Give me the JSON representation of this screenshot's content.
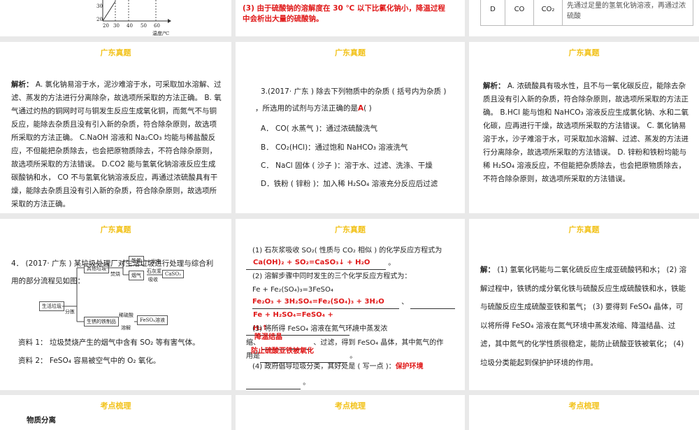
{
  "slide1": {
    "axis_ticks": [
      "20",
      "30",
      "20",
      "30",
      "40",
      "50",
      "60"
    ],
    "axis_label": "温度/℃"
  },
  "slide2": {
    "answer": "(3) 由于硫酸钠的溶解度在 30 ℃ 以下比氯化钠小，降温过程中会析出大量的硫酸钠。"
  },
  "slide3": {
    "row": [
      "D",
      "CO",
      "CO₂",
      "先通过足量的氢氧化钠溶液，再通过浓硫酸"
    ]
  },
  "section_title": "广东真题",
  "slide4": {
    "label": "解析：",
    "text": " A. 氯化钠易溶于水，泥沙难溶于水，可采取加水溶解、过滤、蒸发的方法进行分离除杂，故选项所采取的方法正确。 B. 氧气通过灼热的铜网时可与铜发生反应生成氧化铜，而氮气不与铜反应，能除去杂质且没有引入新的杂质，符合除杂原则，故选项所采取的方法正确。 C.NaOH 溶液和 Na₂CO₃ 均能与稀盐酸反应，不但能把杂质除去，也会把原物质除去，不符合除杂原则，故选项所采取的方法错误。 D.CO2 能与氢氧化钠溶液反应生成碳酸钠和水， CO 不与氢氧化钠溶液反应，再通过浓硫酸具有干燥，能除去杂质且没有引入新的杂质，符合除杂原则，故选项所采取的方法正确。"
  },
  "slide5": {
    "q1": "3.(2017· 广东 ) 除去下列物质中的杂质 ( 括号内为杂质 )",
    "q2": "，所选用的试剂与方法正确的是",
    "answer": "A",
    "paren": "(          )",
    "options": [
      "A． CO( 水蒸气 )：通过浓硫酸洗气",
      "B． CO₂(HCl)：通过饱和 NaHCO₃ 溶液洗气",
      "C． NaCl 固体 ( 沙子 )：溶于水、过滤、洗涤、干燥",
      "D．铁粉 ( 锌粉 )：加入稀 H₂SO₄ 溶液充分反应后过滤"
    ]
  },
  "slide6": {
    "label": "解析：",
    "text": " A. 浓硫酸具有吸水性，且不与一氧化碳反应，能除去杂质且没有引入新的杂质，符合除杂原则，故选项所采取的方法正确。 B.HCl 能与饱和 NaHCO₃ 溶液反应生成氯化钠、水和二氧化碳，应再进行干燥，故选项所采取的方法错误。 C. 氯化钠易溶于水，沙子难溶于水，可采取加水溶解、过滤、蒸发的方法进行分离除杂，故选项所采取的方法错误。 D. 锌粉和铁粉均能与稀 H₂SO₄ 溶液反应，不但能把杂质除去，也会把原物质除去，不符合除杂原则，故选项所采取的方法错误。"
  },
  "slide7": {
    "q": "4． (2017· 广东 ) 某垃圾处理厂对生活垃圾进行处理与综合利用的部分流程见如图：",
    "flow": {
      "start": "生活垃圾",
      "sort": "分拣",
      "other": "其他垃圾",
      "burn": "焚烧",
      "energy": "能量",
      "power": "发电",
      "smoke": "烟气",
      "lime": "石灰浆",
      "absorb": "吸收",
      "caso3": "CaSO₃",
      "rusty": "生锈的铁制品",
      "acid": "稀硫酸",
      "dissolve": "溶解",
      "feso4": "FeSO₄溶液"
    },
    "info1": "资料 1： 垃圾焚烧产生的烟气中含有 SO₂ 等有害气体。",
    "info2": "资料 2： FeSO₄ 容易被空气中的 O₂ 氧化。"
  },
  "slide8": {
    "q1": "(1) 石灰浆吸收 SO₂( 性质与 CO₂ 相似 ) 的化学反应方程式为",
    "a1": "Ca(OH)₂ + SO₂=CaSO₃↓ + H₂O",
    "q2": "(2) 溶解步骤中同时发生的三个化学反应方程式为：",
    "eq1": "Fe + Fe₂(SO₄)₃=3FeSO₄",
    "a2": "Fe₂O₃ + 3H₂SO₄=Fe₂(SO₄)₃ + 3H₂O",
    "a3": "Fe + H₂SO₄=FeSO₄ + H₂↑",
    "q3a": "(3) 将所得 FeSO₄ 溶液在氮气环境中蒸发浓",
    "q3b": "缩、",
    "q3c": "、过滤，得到 FeSO₄ 晶体，其中氮气的作",
    "q3d": "用是",
    "a3a": "降温结晶",
    "a3b": "防止硫酸亚铁被氧化",
    "q4": "(4) 政府倡导垃圾分类，其好处是 ( 写一点 )：",
    "a4": "保护环境",
    "dot": "。",
    "sep": "、"
  },
  "slide9": {
    "label": "解：",
    "text": " (1) 氢氧化钙能与二氧化硫反应生成亚硫酸钙和水； (2) 溶解过程中，铁锈的成分氧化铁与硫酸反应生成硫酸铁和水，铁能与硫酸反应生成硫酸亚铁和氢气； (3) 要得到 FeSO₄ 晶体，可以将所得 FeSO₄ 溶液在氮气环境中蒸发浓缩、降温结晶、过滤，其中氮气的化学性质很稳定，能防止硫酸亚铁被氧化； (4) 垃圾分类能起到保护护环境的作用。"
  },
  "bottom_title": "考点梳理",
  "slide10": {
    "heading": "物质分离"
  }
}
